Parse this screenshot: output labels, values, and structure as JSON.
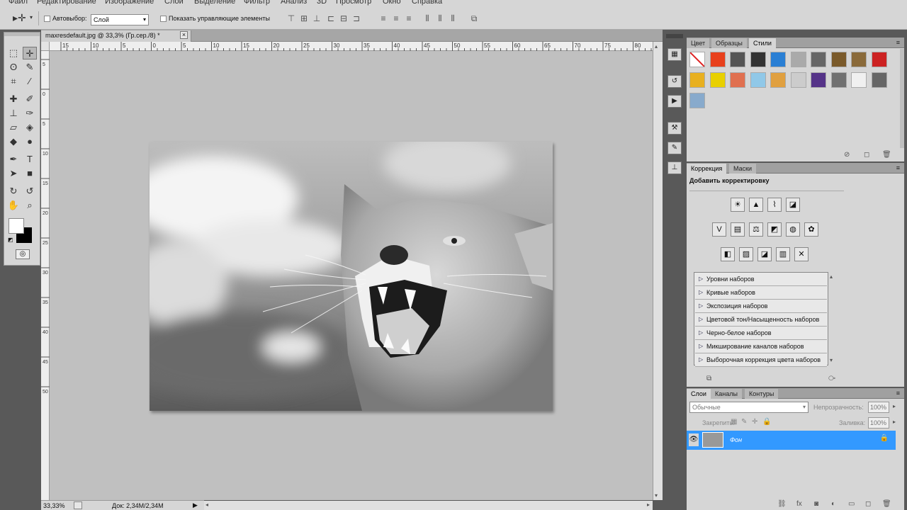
{
  "menu": [
    "Файл",
    "Редактирование",
    "Изображение",
    "Слои",
    "Выделение",
    "Фильтр",
    "Анализ",
    "3D",
    "Просмотр",
    "Окно",
    "Справка"
  ],
  "options_bar": {
    "autoselect_label": "Автовыбор:",
    "autoselect_value": "Слой",
    "show_controls_label": "Показать управляющие элементы"
  },
  "document": {
    "tab_title": "maxresdefault.jpg @ 33,3% (Гр.сер./8) *",
    "close_glyph": "×",
    "image_alt": "Рычащая пума"
  },
  "ruler_h_labels": [
    "15",
    "10",
    "5",
    "0",
    "5",
    "10",
    "15",
    "20",
    "25",
    "30",
    "35",
    "40",
    "45",
    "50",
    "55",
    "60",
    "65",
    "70",
    "75",
    "80"
  ],
  "ruler_v_labels": [
    "5",
    "0",
    "5",
    "10",
    "15",
    "20",
    "25",
    "30",
    "35",
    "40",
    "45",
    "50"
  ],
  "status": {
    "zoom": "33,33%",
    "doc_info": "Док: 2,34M/2,34M"
  },
  "styles_panel": {
    "tabs": [
      "Цвет",
      "Образцы",
      "Стили"
    ],
    "active_tab": "Стили",
    "swatch_colors": [
      "#ffffff",
      "#e8401c",
      "#555555",
      "#333333",
      "#2a7fd4",
      "#aaaaaa",
      "#666666",
      "#7a5a2a",
      "#8a6a3a",
      "#cc2222",
      "#e8b020",
      "#e8d000",
      "#e07050",
      "#90c8e8",
      "#e0a040",
      "#cccccc",
      "#553388",
      "#707070",
      "#f0f0f0",
      "#666666",
      "#88aacc"
    ]
  },
  "adjustments_panel": {
    "tabs": [
      "Коррекция",
      "Маски"
    ],
    "active_tab": "Коррекция",
    "heading": "Добавить корректировку",
    "presets": [
      "Уровни наборов",
      "Кривые наборов",
      "Экспозиция наборов",
      "Цветовой тон/Насыщенность наборов",
      "Черно-белое наборов",
      "Микширование каналов наборов",
      "Выборочная коррекция цвета наборов"
    ]
  },
  "layers_panel": {
    "tabs": [
      "Слои",
      "Каналы",
      "Контуры"
    ],
    "active_tab": "Слои",
    "blend_mode": "Обычные",
    "opacity_label": "Непрозрачность:",
    "opacity_value": "100%",
    "lock_label": "Закрепить:",
    "fill_label": "Заливка:",
    "fill_value": "100%",
    "layers": [
      {
        "name": "Фон",
        "selected": true
      }
    ],
    "selected_color": "#3399ff"
  }
}
